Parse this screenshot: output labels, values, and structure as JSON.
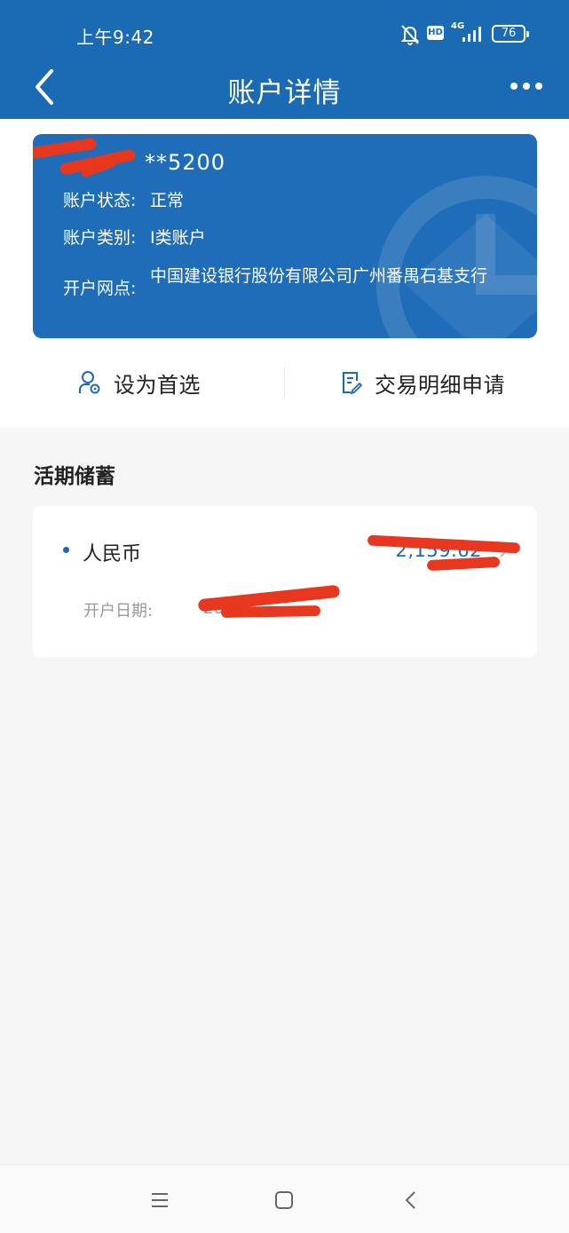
{
  "status_bar": {
    "time": "上午9:42",
    "hd": "HD",
    "network": "4G",
    "battery": "76",
    "icons": [
      "bell-muted-icon",
      "hd-icon",
      "signal-icon",
      "battery-icon"
    ]
  },
  "nav": {
    "title": "账户详情",
    "back_icon": "chevron-left-icon",
    "more_icon": "more-dots-icon"
  },
  "account_card": {
    "number_suffix": "**5200",
    "rows": [
      {
        "key": "账户状态:",
        "value": "正常"
      },
      {
        "key": "账户类别:",
        "value": "I类账户"
      },
      {
        "key": "开户网点:",
        "value": "中国建设银行股份有限公司广州番禺石基支行"
      }
    ],
    "background_color": "#1f6db8"
  },
  "actions": {
    "set_preferred": {
      "label": "设为首选",
      "icon": "user-settings-icon"
    },
    "transaction_request": {
      "label": "交易明细申请",
      "icon": "document-edit-icon"
    }
  },
  "savings": {
    "section_title": "活期储蓄",
    "currency": "人民币",
    "balance": "2,159.62",
    "open_date_label": "开户日期:",
    "open_date_value": "20"
  },
  "colors": {
    "primary": "#1b6ab4",
    "redaction": "#e8371f"
  }
}
